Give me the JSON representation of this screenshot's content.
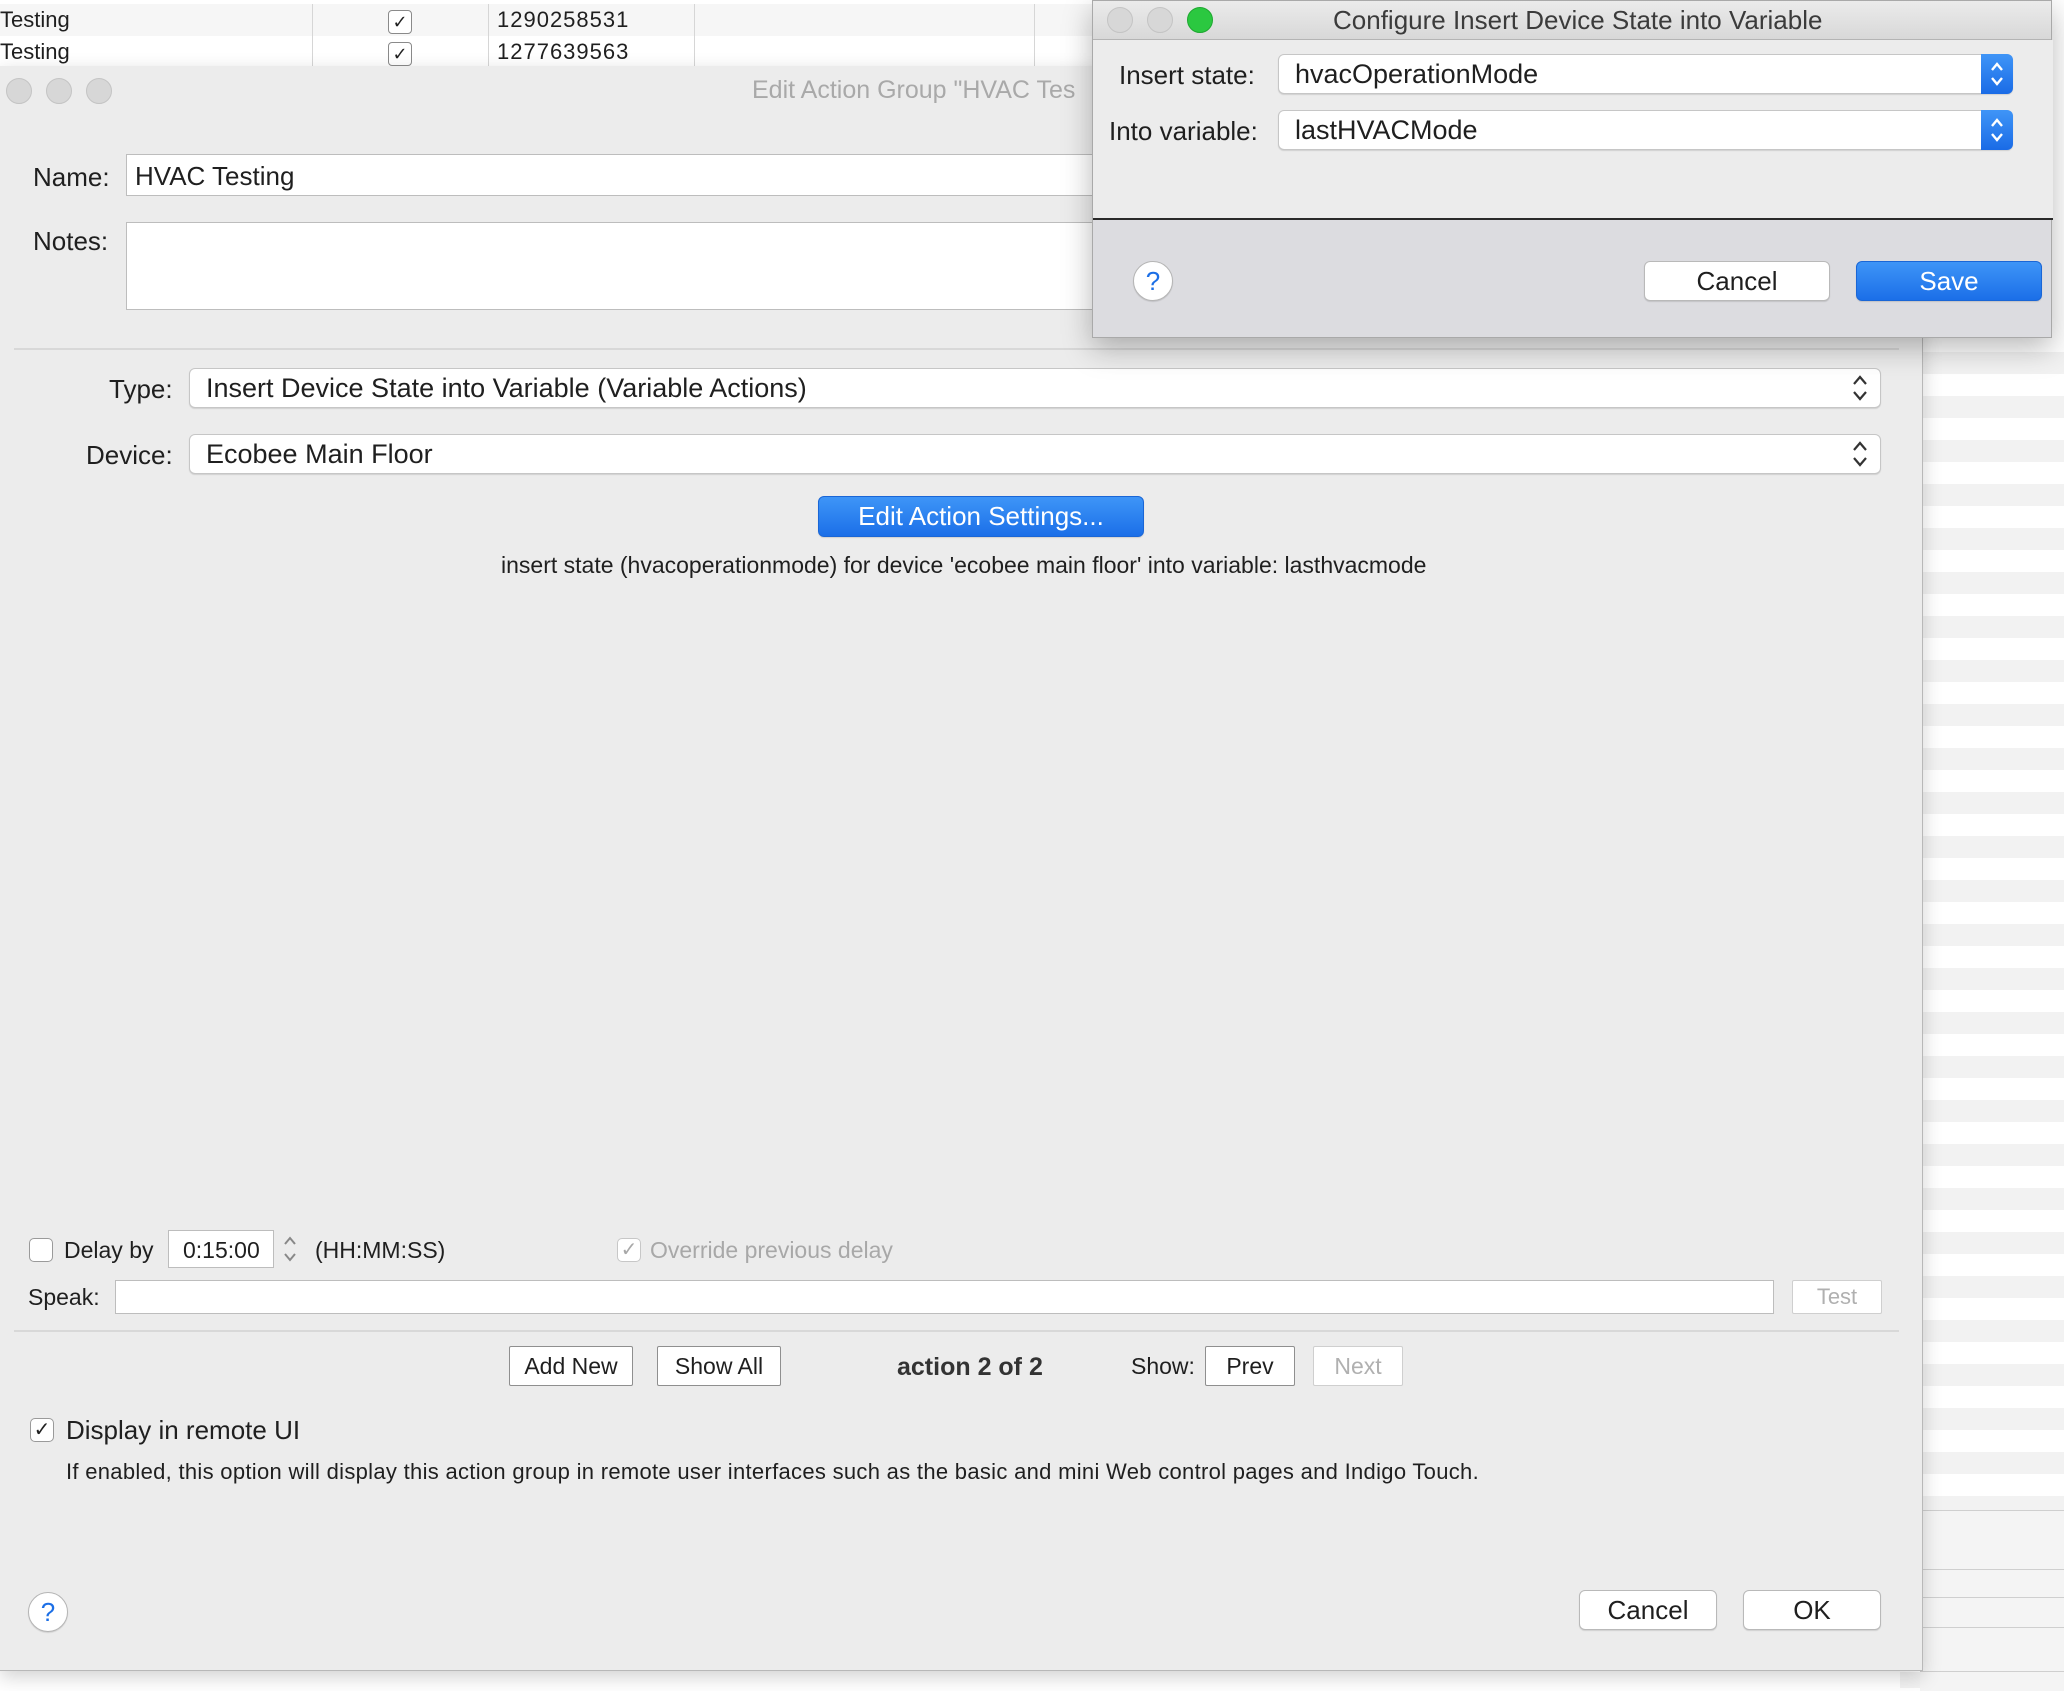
{
  "background_table": {
    "rows": [
      {
        "name": "Testing",
        "checked": "✓",
        "value": "1290258531"
      },
      {
        "name": "Testing",
        "checked": "✓",
        "value": "1277639563"
      }
    ]
  },
  "main_dialog": {
    "title": "Edit Action Group \"HVAC Tes",
    "name_label": "Name:",
    "name_value": "HVAC Testing",
    "notes_label": "Notes:",
    "notes_value": "",
    "type_label": "Type:",
    "type_value": "Insert Device State into Variable (Variable Actions)",
    "device_label": "Device:",
    "device_value": "Ecobee Main Floor",
    "edit_settings_label": "Edit Action Settings...",
    "action_summary": "insert state (hvacoperationmode) for device 'ecobee main floor' into variable: lasthvacmode",
    "delay_label": "Delay by",
    "delay_value": "0:15:00",
    "delay_format": "(HH:MM:SS)",
    "override_label": "Override previous delay",
    "override_check": "✓",
    "speak_label": "Speak:",
    "speak_value": "",
    "test_label": "Test",
    "add_new_label": "Add New",
    "show_all_label": "Show All",
    "action_counter": "action 2 of 2",
    "show_label": "Show:",
    "prev_label": "Prev",
    "next_label": "Next",
    "remote_ui_label": "Display in remote UI",
    "remote_ui_check": "✓",
    "remote_ui_desc": "If enabled, this option will display this action group in remote user interfaces such as the basic and mini Web control pages and Indigo Touch.",
    "help_glyph": "?",
    "cancel_label": "Cancel",
    "ok_label": "OK"
  },
  "configure_dialog": {
    "title": "Configure Insert Device State into Variable",
    "insert_state_label": "Insert state:",
    "insert_state_value": "hvacOperationMode",
    "into_variable_label": "Into variable:",
    "into_variable_value": "lastHVACMode",
    "help_glyph": "?",
    "cancel_label": "Cancel",
    "save_label": "Save"
  },
  "colors": {
    "accent_blue": "#1b6fe8",
    "traffic_close_inactive": "#d7d7d7",
    "traffic_zoom_active": "#2bc840"
  }
}
